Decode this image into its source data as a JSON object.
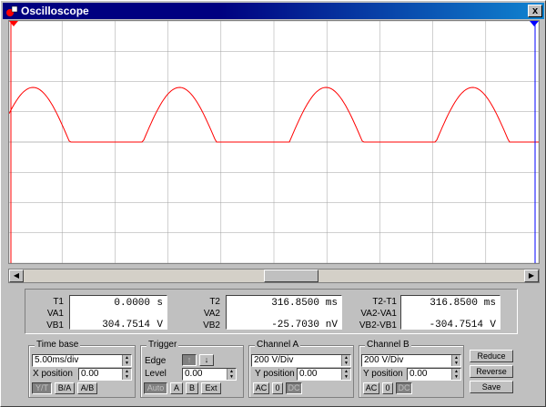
{
  "window": {
    "title": "Oscilloscope",
    "close_label": "x"
  },
  "readout": {
    "t1": {
      "label": "T1",
      "value": "0.0000",
      "unit": "s"
    },
    "va1": {
      "label": "VA1"
    },
    "vb1": {
      "label": "VB1",
      "value": "304.7514",
      "unit": "V"
    },
    "t2": {
      "label": "T2",
      "value": "316.8500",
      "unit": "ms"
    },
    "va2": {
      "label": "VA2"
    },
    "vb2": {
      "label": "VB2",
      "value": "-25.7030",
      "unit": "nV"
    },
    "dt": {
      "label": "T2-T1",
      "value": "316.8500",
      "unit": "ms"
    },
    "dva": {
      "label": "VA2-VA1"
    },
    "dvb": {
      "label": "VB2-VB1",
      "value": "-304.7514",
      "unit": "V"
    }
  },
  "timebase": {
    "title": "Time base",
    "value": "5.00ms/div",
    "xpos_label": "X position",
    "xpos": "0.00",
    "modes": [
      "Y/T",
      "B/A",
      "A/B"
    ]
  },
  "trigger": {
    "title": "Trigger",
    "edge_label": "Edge",
    "level_label": "Level",
    "level": "0.00",
    "sources": [
      "Auto",
      "A",
      "B",
      "Ext"
    ]
  },
  "channel_a": {
    "title": "Channel A",
    "value": "200 V/Div",
    "ypos_label": "Y position",
    "ypos": "0.00",
    "coupling": [
      "AC",
      "0",
      "DC"
    ]
  },
  "channel_b": {
    "title": "Channel B",
    "value": "200 V/Div",
    "ypos_label": "Y position",
    "ypos": "0.00",
    "coupling": [
      "AC",
      "0",
      "DC"
    ]
  },
  "buttons": {
    "reduce": "Reduce",
    "reverse": "Reverse",
    "save": "Save"
  },
  "colors": {
    "trace": "#ff0000",
    "cursor": "#0000ff",
    "grid": "#a0a0a0"
  }
}
